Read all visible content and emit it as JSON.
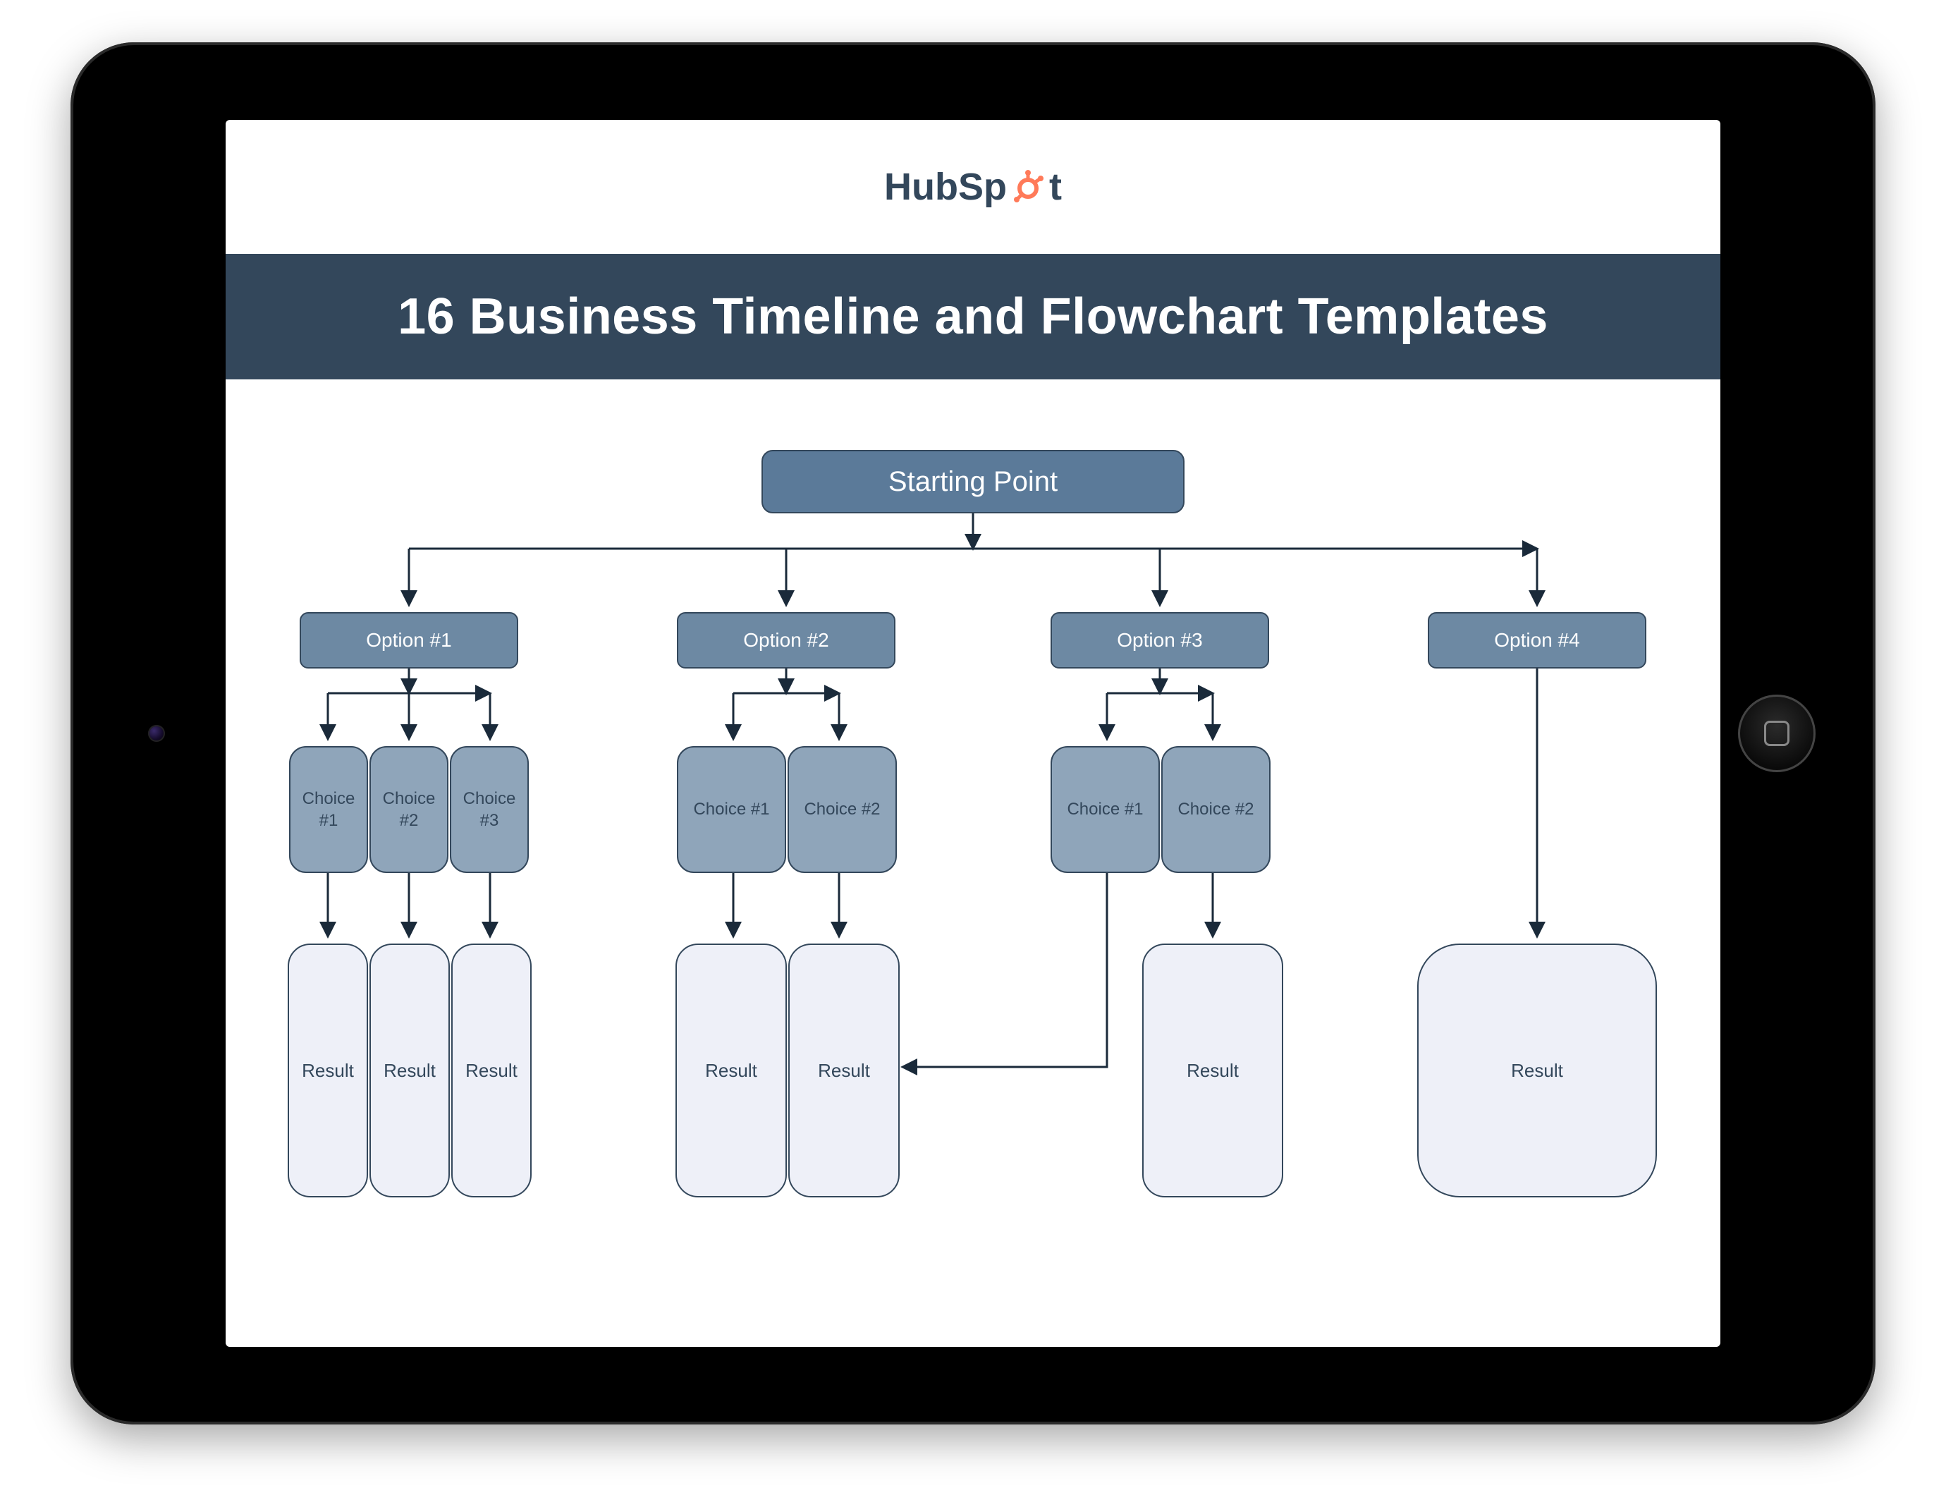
{
  "brand": {
    "name_pre": "HubSp",
    "name_post": "t",
    "accent": "#ff7a59"
  },
  "title": "16 Business Timeline and Flowchart Templates",
  "flow": {
    "start": "Starting Point",
    "options": [
      "Option #1",
      "Option #2",
      "Option #3",
      "Option #4"
    ],
    "choices": {
      "opt1": [
        "Choice #1",
        "Choice #2",
        "Choice #3"
      ],
      "opt2": [
        "Choice #1",
        "Choice #2"
      ],
      "opt3": [
        "Choice #1",
        "Choice #2"
      ]
    },
    "result_label": "Result"
  }
}
